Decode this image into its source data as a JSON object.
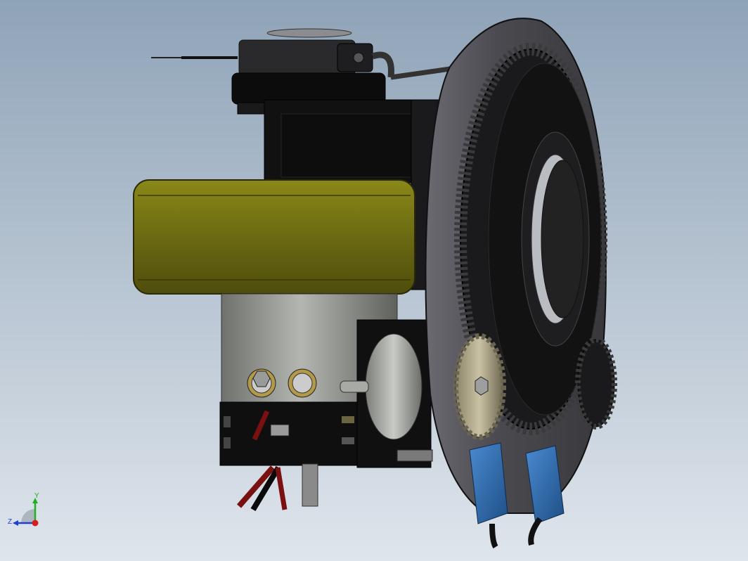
{
  "viewport": {
    "background_top": "#8fa3b8",
    "background_bottom": "#dfe5ec"
  },
  "model": {
    "wheel_color": "#6b6a12",
    "motor_color": "#9a9c98",
    "dark_parts_color": "#111111",
    "plate_color": "#4a4a4e",
    "switch_color": "#2f6fb0",
    "wire_red_color": "#7a1010"
  },
  "triad": {
    "x_label": "",
    "y_label": "Y",
    "z_label": "Z",
    "x_color": "#d02020",
    "y_color": "#20b020",
    "z_color": "#2040d0"
  }
}
